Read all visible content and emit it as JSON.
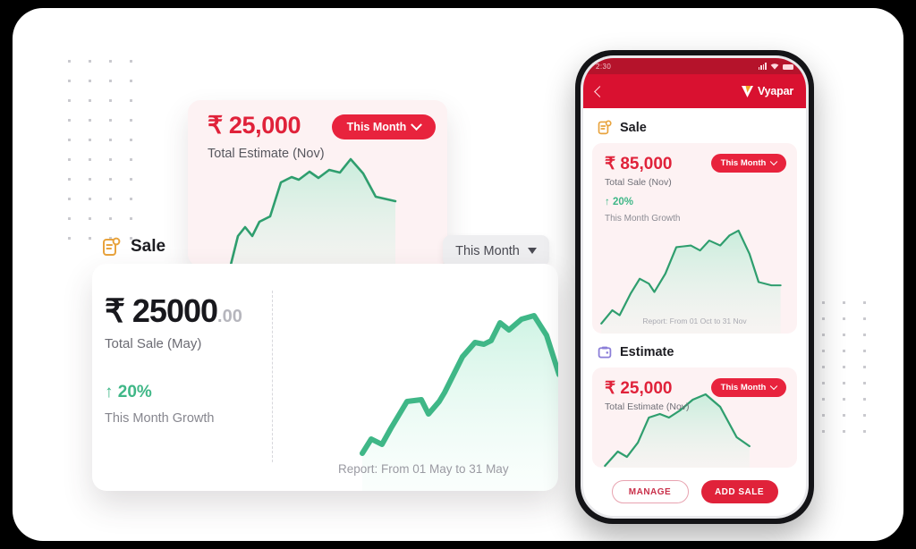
{
  "estimate_card": {
    "amount": "₹ 25,000",
    "label": "Total Estimate (Nov)",
    "period_pill": "This Month",
    "chevron_icon": "chevron-down-icon"
  },
  "grey_dropdown": {
    "label": "This Month",
    "caret_icon": "caret-down-icon"
  },
  "sale_section": {
    "icon": "sale-document-icon",
    "title": "Sale"
  },
  "sale_card": {
    "amount_main": "₹ 25000",
    "amount_decimal": ".00",
    "label": "Total Sale (May)",
    "growth_arrow": "↑",
    "growth_value": "20%",
    "growth_label": "This Month Growth",
    "report": "Report: From 01 May to 31 May"
  },
  "phone": {
    "status_bar": {
      "time": "2:30",
      "signal_icon": "signal-bars-icon",
      "wifi_icon": "wifi-icon",
      "battery_icon": "battery-icon"
    },
    "app_bar": {
      "back_icon": "back-chevron-icon",
      "logo_icon": "vyapar-logo-icon",
      "brand": "Vyapar"
    },
    "sale_section": {
      "icon": "sale-document-icon",
      "title": "Sale",
      "amount": "₹ 85,000",
      "label": "Total Sale (Nov)",
      "period_pill": "This Month",
      "growth_value": "↑ 20%",
      "growth_label": "This Month Growth",
      "report": "Report: From 01 Oct to 31 Nov"
    },
    "estimate_section": {
      "icon": "estimate-wallet-icon",
      "title": "Estimate",
      "amount": "₹ 25,000",
      "label": "Total Estimate (Nov)",
      "period_pill": "This Month"
    },
    "actions": {
      "manage": "MANAGE",
      "add_sale": "ADD SALE"
    }
  },
  "colors": {
    "brand_red": "#e0223a",
    "app_bar_red": "#d91130",
    "growth_green": "#3fb787",
    "chart_green": "#34a574",
    "card_pink": "#fdf2f3",
    "icon_amber": "#e8a33d",
    "icon_violet": "#8b7ed8"
  },
  "chart_data": [
    {
      "type": "area",
      "name": "estimate-card-chart",
      "title": "Total Estimate (Nov)",
      "x": [
        0,
        1,
        2,
        3,
        4,
        5,
        6,
        7,
        8,
        9,
        10,
        11,
        12,
        13,
        14,
        15,
        16
      ],
      "values": [
        2,
        10,
        22,
        17,
        24,
        27,
        52,
        57,
        55,
        60,
        72,
        68,
        74,
        86,
        74,
        38,
        33
      ],
      "ylim": [
        0,
        100
      ],
      "grid": false,
      "legend": "none"
    },
    {
      "type": "area",
      "name": "sale-card-chart",
      "title": "Total Sale (May)",
      "xlabel": "",
      "ylabel": "",
      "x": [
        0,
        1,
        2,
        3,
        4,
        5,
        6,
        7,
        8,
        9,
        10,
        11,
        12,
        13,
        14,
        15,
        16,
        17,
        18
      ],
      "values": [
        4,
        14,
        10,
        20,
        34,
        36,
        26,
        40,
        42,
        62,
        74,
        72,
        76,
        86,
        82,
        88,
        94,
        86,
        46,
        40
      ],
      "ylim": [
        0,
        100
      ],
      "grid": false,
      "legend": "none"
    },
    {
      "type": "area",
      "name": "phone-sale-chart",
      "title": "Total Sale (Nov)",
      "x": [
        0,
        1,
        2,
        3,
        4,
        5,
        6,
        7,
        8,
        9,
        10,
        11,
        12,
        13,
        14,
        15,
        16
      ],
      "values": [
        6,
        16,
        12,
        22,
        40,
        36,
        30,
        46,
        68,
        70,
        66,
        74,
        70,
        80,
        88,
        50,
        44
      ],
      "ylim": [
        0,
        100
      ],
      "grid": false,
      "legend": "none"
    },
    {
      "type": "area",
      "name": "phone-estimate-chart",
      "title": "Total Estimate (Nov)",
      "x": [
        0,
        1,
        2,
        3,
        4,
        5,
        6,
        7,
        8,
        9,
        10,
        11,
        12
      ],
      "values": [
        10,
        26,
        18,
        30,
        56,
        62,
        58,
        66,
        78,
        90,
        82,
        52,
        40
      ],
      "ylim": [
        0,
        100
      ],
      "grid": false,
      "legend": "none"
    }
  ]
}
